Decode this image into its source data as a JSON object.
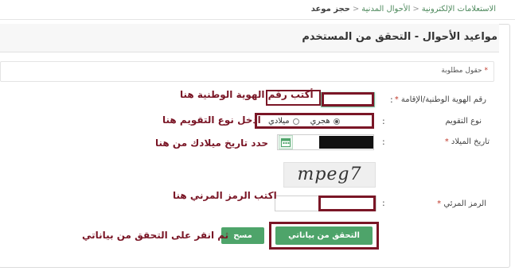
{
  "breadcrumb": {
    "root": "الاستعلامات الإلكترونية",
    "section": "الأحوال المدنية",
    "current": "حجز موعد"
  },
  "panel": {
    "title": "مواعيد الأحوال - التحقق من المستخدم"
  },
  "form": {
    "required_note": "حقول مطلوبة",
    "id_label": "رقم الهوية الوطنية/الإقامة",
    "calendar_label": "نوع التقويم",
    "calendar_options": [
      "هجري",
      "ميلادي"
    ],
    "calendar_selected": "هجري",
    "dob_label": "تاريخ الميلاد",
    "captcha_label": "الرمز المرئي",
    "captcha_image_text": "mpeg7",
    "required_mark": "*",
    "colon": ":",
    "verify_button": "التحقق من بياناتي",
    "clear_button": "مسح"
  },
  "annotations": {
    "id_hint": "أكتب رقم الهوية الوطنية هنا",
    "calendar_hint": "ادخل نوع التقويم هنا",
    "dob_hint": "حدد تاريخ ميلادك من هنا",
    "captcha_hint": "اكتب الرمز المرني هنا",
    "submit_hint": "ثم انقر على التحقق من بياناتي"
  },
  "colors": {
    "accent_green": "#4ea46a",
    "annotation_red": "#7a1626",
    "required_star": "#c0392b"
  },
  "icons": {
    "calendar": "calendar-icon"
  }
}
